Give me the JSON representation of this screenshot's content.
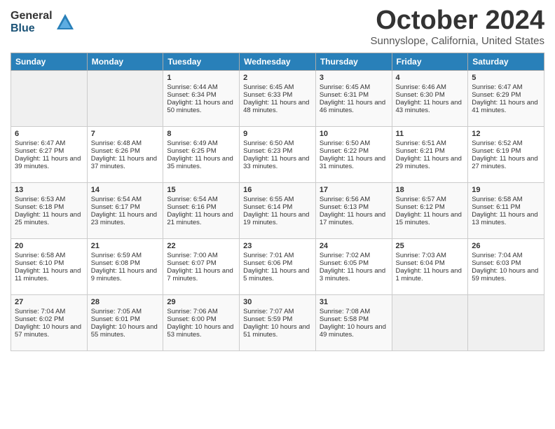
{
  "logo": {
    "general": "General",
    "blue": "Blue"
  },
  "title": "October 2024",
  "location": "Sunnyslope, California, United States",
  "days_of_week": [
    "Sunday",
    "Monday",
    "Tuesday",
    "Wednesday",
    "Thursday",
    "Friday",
    "Saturday"
  ],
  "weeks": [
    [
      {
        "day": "",
        "sunrise": "",
        "sunset": "",
        "daylight": "",
        "empty": true
      },
      {
        "day": "",
        "sunrise": "",
        "sunset": "",
        "daylight": "",
        "empty": true
      },
      {
        "day": "1",
        "sunrise": "Sunrise: 6:44 AM",
        "sunset": "Sunset: 6:34 PM",
        "daylight": "Daylight: 11 hours and 50 minutes."
      },
      {
        "day": "2",
        "sunrise": "Sunrise: 6:45 AM",
        "sunset": "Sunset: 6:33 PM",
        "daylight": "Daylight: 11 hours and 48 minutes."
      },
      {
        "day": "3",
        "sunrise": "Sunrise: 6:45 AM",
        "sunset": "Sunset: 6:31 PM",
        "daylight": "Daylight: 11 hours and 46 minutes."
      },
      {
        "day": "4",
        "sunrise": "Sunrise: 6:46 AM",
        "sunset": "Sunset: 6:30 PM",
        "daylight": "Daylight: 11 hours and 43 minutes."
      },
      {
        "day": "5",
        "sunrise": "Sunrise: 6:47 AM",
        "sunset": "Sunset: 6:29 PM",
        "daylight": "Daylight: 11 hours and 41 minutes."
      }
    ],
    [
      {
        "day": "6",
        "sunrise": "Sunrise: 6:47 AM",
        "sunset": "Sunset: 6:27 PM",
        "daylight": "Daylight: 11 hours and 39 minutes."
      },
      {
        "day": "7",
        "sunrise": "Sunrise: 6:48 AM",
        "sunset": "Sunset: 6:26 PM",
        "daylight": "Daylight: 11 hours and 37 minutes."
      },
      {
        "day": "8",
        "sunrise": "Sunrise: 6:49 AM",
        "sunset": "Sunset: 6:25 PM",
        "daylight": "Daylight: 11 hours and 35 minutes."
      },
      {
        "day": "9",
        "sunrise": "Sunrise: 6:50 AM",
        "sunset": "Sunset: 6:23 PM",
        "daylight": "Daylight: 11 hours and 33 minutes."
      },
      {
        "day": "10",
        "sunrise": "Sunrise: 6:50 AM",
        "sunset": "Sunset: 6:22 PM",
        "daylight": "Daylight: 11 hours and 31 minutes."
      },
      {
        "day": "11",
        "sunrise": "Sunrise: 6:51 AM",
        "sunset": "Sunset: 6:21 PM",
        "daylight": "Daylight: 11 hours and 29 minutes."
      },
      {
        "day": "12",
        "sunrise": "Sunrise: 6:52 AM",
        "sunset": "Sunset: 6:19 PM",
        "daylight": "Daylight: 11 hours and 27 minutes."
      }
    ],
    [
      {
        "day": "13",
        "sunrise": "Sunrise: 6:53 AM",
        "sunset": "Sunset: 6:18 PM",
        "daylight": "Daylight: 11 hours and 25 minutes."
      },
      {
        "day": "14",
        "sunrise": "Sunrise: 6:54 AM",
        "sunset": "Sunset: 6:17 PM",
        "daylight": "Daylight: 11 hours and 23 minutes."
      },
      {
        "day": "15",
        "sunrise": "Sunrise: 6:54 AM",
        "sunset": "Sunset: 6:16 PM",
        "daylight": "Daylight: 11 hours and 21 minutes."
      },
      {
        "day": "16",
        "sunrise": "Sunrise: 6:55 AM",
        "sunset": "Sunset: 6:14 PM",
        "daylight": "Daylight: 11 hours and 19 minutes."
      },
      {
        "day": "17",
        "sunrise": "Sunrise: 6:56 AM",
        "sunset": "Sunset: 6:13 PM",
        "daylight": "Daylight: 11 hours and 17 minutes."
      },
      {
        "day": "18",
        "sunrise": "Sunrise: 6:57 AM",
        "sunset": "Sunset: 6:12 PM",
        "daylight": "Daylight: 11 hours and 15 minutes."
      },
      {
        "day": "19",
        "sunrise": "Sunrise: 6:58 AM",
        "sunset": "Sunset: 6:11 PM",
        "daylight": "Daylight: 11 hours and 13 minutes."
      }
    ],
    [
      {
        "day": "20",
        "sunrise": "Sunrise: 6:58 AM",
        "sunset": "Sunset: 6:10 PM",
        "daylight": "Daylight: 11 hours and 11 minutes."
      },
      {
        "day": "21",
        "sunrise": "Sunrise: 6:59 AM",
        "sunset": "Sunset: 6:08 PM",
        "daylight": "Daylight: 11 hours and 9 minutes."
      },
      {
        "day": "22",
        "sunrise": "Sunrise: 7:00 AM",
        "sunset": "Sunset: 6:07 PM",
        "daylight": "Daylight: 11 hours and 7 minutes."
      },
      {
        "day": "23",
        "sunrise": "Sunrise: 7:01 AM",
        "sunset": "Sunset: 6:06 PM",
        "daylight": "Daylight: 11 hours and 5 minutes."
      },
      {
        "day": "24",
        "sunrise": "Sunrise: 7:02 AM",
        "sunset": "Sunset: 6:05 PM",
        "daylight": "Daylight: 11 hours and 3 minutes."
      },
      {
        "day": "25",
        "sunrise": "Sunrise: 7:03 AM",
        "sunset": "Sunset: 6:04 PM",
        "daylight": "Daylight: 11 hours and 1 minute."
      },
      {
        "day": "26",
        "sunrise": "Sunrise: 7:04 AM",
        "sunset": "Sunset: 6:03 PM",
        "daylight": "Daylight: 10 hours and 59 minutes."
      }
    ],
    [
      {
        "day": "27",
        "sunrise": "Sunrise: 7:04 AM",
        "sunset": "Sunset: 6:02 PM",
        "daylight": "Daylight: 10 hours and 57 minutes."
      },
      {
        "day": "28",
        "sunrise": "Sunrise: 7:05 AM",
        "sunset": "Sunset: 6:01 PM",
        "daylight": "Daylight: 10 hours and 55 minutes."
      },
      {
        "day": "29",
        "sunrise": "Sunrise: 7:06 AM",
        "sunset": "Sunset: 6:00 PM",
        "daylight": "Daylight: 10 hours and 53 minutes."
      },
      {
        "day": "30",
        "sunrise": "Sunrise: 7:07 AM",
        "sunset": "Sunset: 5:59 PM",
        "daylight": "Daylight: 10 hours and 51 minutes."
      },
      {
        "day": "31",
        "sunrise": "Sunrise: 7:08 AM",
        "sunset": "Sunset: 5:58 PM",
        "daylight": "Daylight: 10 hours and 49 minutes."
      },
      {
        "day": "",
        "sunrise": "",
        "sunset": "",
        "daylight": "",
        "empty": true
      },
      {
        "day": "",
        "sunrise": "",
        "sunset": "",
        "daylight": "",
        "empty": true
      }
    ]
  ]
}
